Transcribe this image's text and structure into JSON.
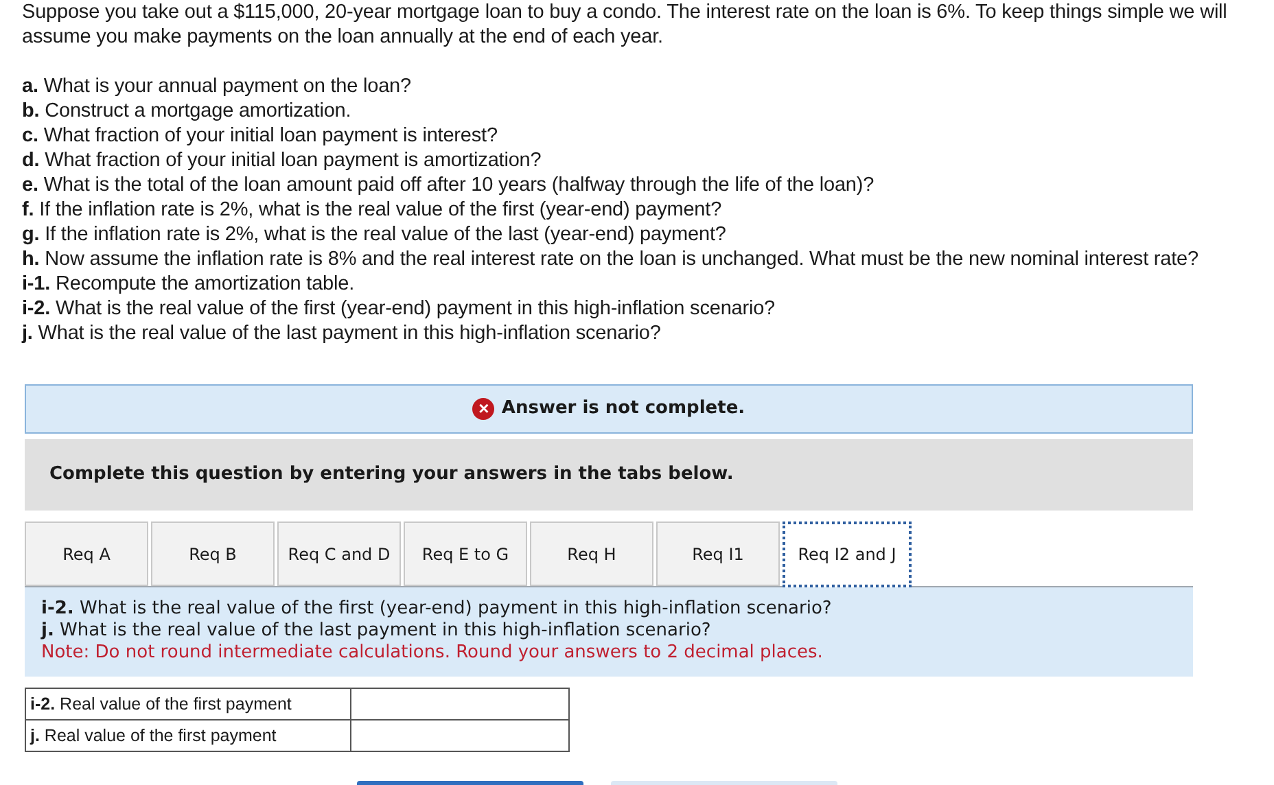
{
  "intro": "Suppose you take out a $115,000, 20-year mortgage loan to buy a condo. The interest rate on the loan is 6%. To keep things simple we will assume you make payments on the loan annually at the end of each year.",
  "questions": [
    "**a.** What is your annual payment on the loan?",
    "**b.** Construct a mortgage amortization.",
    "**c.** What fraction of your initial loan payment is interest?",
    "**d.** What fraction of your initial loan payment is amortization?",
    "**e.** What is the total of the loan amount paid off after 10 years (halfway through the life of the loan)?",
    "**f.** If the inflation rate is 2%, what is the real value of the first (year-end) payment?",
    "**g.** If the inflation rate is 2%, what is the real value of the last (year-end) payment?",
    "**h.** Now assume the inflation rate is 8% and the real interest rate on the loan is unchanged. What must be the new nominal interest rate?",
    "**i-1.** Recompute the amortization table.",
    "**i-2.** What is the real value of the first (year-end) payment in this high-inflation scenario?",
    "**j.** What is the real value of the last payment in this high-inflation scenario?"
  ],
  "banner": {
    "icon": "×",
    "text": "Answer is not complete."
  },
  "instruction": "Complete this question by entering your answers in the tabs below.",
  "tabs": [
    {
      "label": "Req A",
      "selected": false
    },
    {
      "label": "Req B",
      "selected": false
    },
    {
      "label": "Req C and D",
      "selected": false
    },
    {
      "label": "Req E to G",
      "selected": false
    },
    {
      "label": "Req H",
      "selected": false
    },
    {
      "label": "Req I1",
      "selected": false
    },
    {
      "label": "Req I2 and J",
      "selected": true
    }
  ],
  "panel": {
    "questions": [
      "**i-2.** What is the real value of the first (year-end) payment in this high-inflation scenario?",
      "**j.** What is the real value of the last payment in this high-inflation scenario?"
    ],
    "note": "Note: Do not round intermediate calculations. Round your answers to 2 decimal places."
  },
  "answer_rows": [
    {
      "label": "**i-2.** Real value of the first payment"
    },
    {
      "label": "**j.** Real value of the first payment"
    }
  ]
}
